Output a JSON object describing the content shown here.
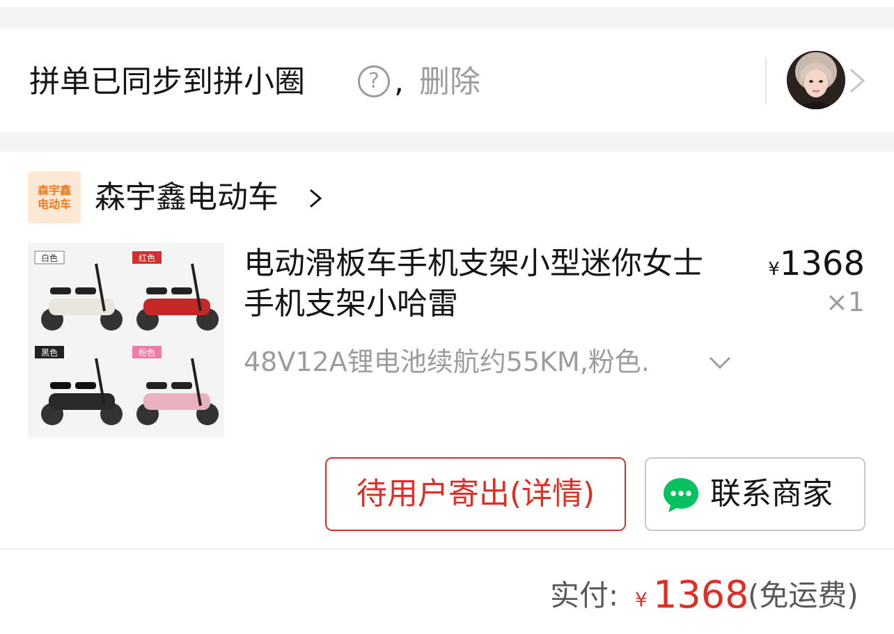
{
  "colors": {
    "accent_red": "#e02e24",
    "text_primary": "#151516",
    "text_secondary": "#9c9c9c",
    "separator": "#f4f4f4",
    "wechat_green": "#07c160",
    "store_logo_bg": "#fde7d5",
    "store_logo_text": "#f07a1c"
  },
  "sync_banner": {
    "text": "拼单已同步到拼小圈",
    "help_symbol": "?",
    "comma": ",",
    "delete_label": "删除",
    "avatar_icon": "user-avatar",
    "chevron_icon": "chevron-right-icon"
  },
  "store": {
    "logo_line1": "森宇鑫",
    "logo_line2": "电动车",
    "name": "森宇鑫电动车",
    "chevron_icon": "chevron-right-icon"
  },
  "product": {
    "image_labels": [
      "白色",
      "红色",
      "黑色",
      "粉色"
    ],
    "title": "电动滑板车手机支架小型迷你女士手机支架小哈雷",
    "spec": "48V12A锂电池续航约55KM,粉色.",
    "spec_chevron_icon": "chevron-down-icon",
    "currency": "¥",
    "price": "1368",
    "quantity": "×1"
  },
  "actions": {
    "wait_label": "待用户寄出(详情)",
    "contact_label": "联系商家",
    "contact_icon": "chat-bubble-icon"
  },
  "footer": {
    "paid_label": "实付:",
    "currency": "¥",
    "amount": "1368",
    "shipping_note": "(免运费)"
  }
}
